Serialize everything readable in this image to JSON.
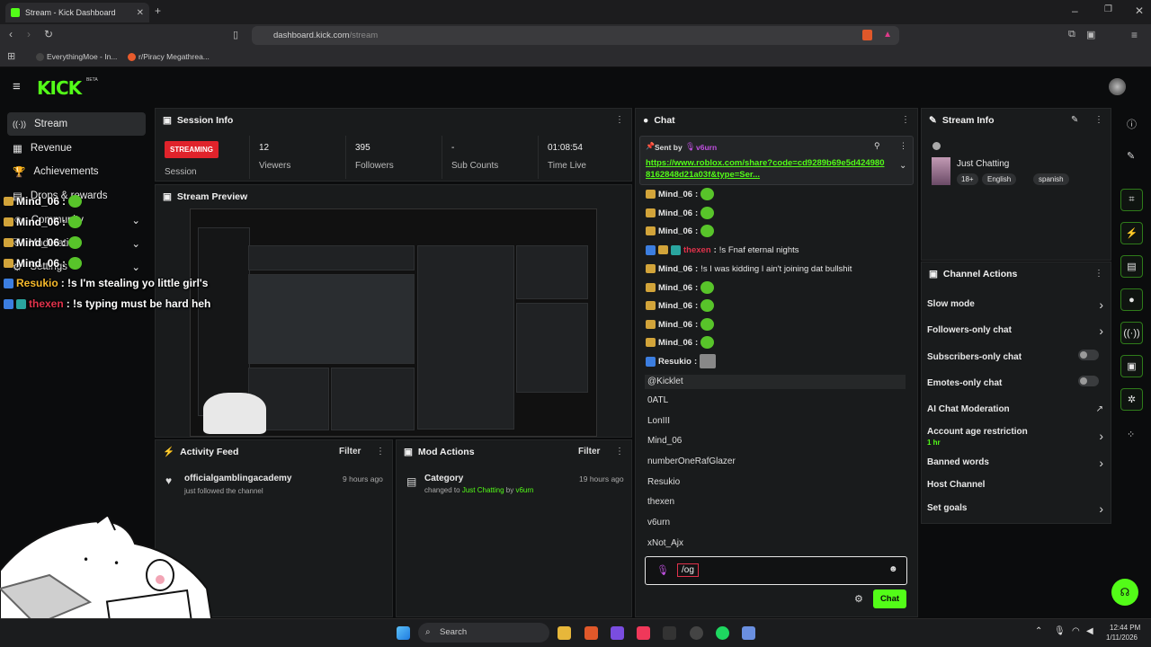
{
  "browser": {
    "tab_title": "Stream - Kick Dashboard",
    "url_host": "dashboard.kick.com",
    "url_path": "/stream",
    "bookmarks": [
      "EverythingMoe - In...",
      "r/Piracy Megathrea..."
    ]
  },
  "app": {
    "logo": "KICK",
    "logo_badge": "BETA",
    "accent": "#53fc18"
  },
  "sidebar": {
    "items": [
      {
        "label": "Stream",
        "icon": "stream-icon",
        "active": true
      },
      {
        "label": "Revenue",
        "icon": "revenue-icon"
      },
      {
        "label": "Achievements",
        "icon": "trophy-icon"
      },
      {
        "label": "Drops & rewards",
        "icon": "gift-icon"
      },
      {
        "label": "Community",
        "icon": "users-icon"
      },
      {
        "label": "Moderation",
        "icon": "shield-icon"
      },
      {
        "label": "Settings",
        "icon": "gear-icon"
      }
    ]
  },
  "session": {
    "title": "Session Info",
    "badge": "STREAMING",
    "session_label": "Session",
    "viewers_value": "12",
    "viewers_label": "Viewers",
    "followers_value": "395",
    "followers_label": "Followers",
    "subs_value": "-",
    "subs_label": "Sub Counts",
    "time_value": "01:08:54",
    "time_label": "Time Live"
  },
  "preview": {
    "title": "Stream Preview"
  },
  "activity": {
    "title": "Activity Feed",
    "filter": "Filter",
    "items": [
      {
        "user": "officialgamblingacademy",
        "detail": "just followed the channel",
        "time": "9 hours ago"
      }
    ]
  },
  "mod_actions": {
    "title": "Mod Actions",
    "filter": "Filter",
    "items": [
      {
        "title": "Category",
        "prefix": "changed to",
        "category": "Just Chatting",
        "by": "by",
        "user": "v6urn",
        "time": "19 hours ago"
      }
    ]
  },
  "chat": {
    "title": "Chat",
    "pinned": {
      "sent_by_label": "Sent by",
      "sender": "v6urn",
      "link": "https://www.roblox.com/share?code=cd9289b69e5d4249808162848d21a03f&type=Ser..."
    },
    "messages": [
      {
        "user": "Mind_06",
        "text": ""
      },
      {
        "user": "Mind_06",
        "text": ""
      },
      {
        "user": "Mind_06",
        "text": ""
      },
      {
        "user": "thexen",
        "text": "!s Fnaf eternal nights",
        "color": "#e0324b"
      },
      {
        "user": "Mind_06",
        "text": "!s I was kidding I ain't joining dat bullshit"
      },
      {
        "user": "Mind_06",
        "text": ""
      },
      {
        "user": "Mind_06",
        "text": ""
      },
      {
        "user": "Mind_06",
        "text": ""
      },
      {
        "user": "Mind_06",
        "text": ""
      },
      {
        "user": "Resukio",
        "text": ""
      }
    ],
    "suggestions": [
      "@Kicklet",
      "0ATL",
      "LonIII",
      "Mind_06",
      "numberOneRafGlazer",
      "Resukio",
      "thexen",
      "v6urn",
      "xNot_Ajx"
    ],
    "input_value": "/og",
    "send_label": "Chat"
  },
  "stream_info": {
    "title": "Stream Info",
    "category": "Just Chatting",
    "tags": [
      "18+",
      "English",
      "spanish"
    ]
  },
  "channel_actions": {
    "title": "Channel Actions",
    "rows": [
      {
        "label": "Slow mode",
        "kind": "chevron"
      },
      {
        "label": "Followers-only chat",
        "kind": "chevron"
      },
      {
        "label": "Subscribers-only chat",
        "kind": "toggle"
      },
      {
        "label": "Emotes-only chat",
        "kind": "toggle"
      },
      {
        "label": "AI Chat Moderation",
        "kind": "external"
      },
      {
        "label": "Account age restriction",
        "sub": "1 hr",
        "kind": "chevron"
      },
      {
        "label": "Banned words",
        "kind": "chevron"
      },
      {
        "label": "Host Channel",
        "kind": "none"
      },
      {
        "label": "Set goals",
        "kind": "chevron"
      }
    ]
  },
  "overlay_chat": [
    {
      "user": "Mind_06",
      "text": ":"
    },
    {
      "user": "Mind_06",
      "text": ":"
    },
    {
      "user": "Mind_06",
      "text": ":"
    },
    {
      "user": "Mind_06",
      "text": ":"
    },
    {
      "user": "Resukio",
      "text": ": !s I'm stealing yo little girl's",
      "color": "#f6b92b"
    },
    {
      "user": "thexen",
      "text": ": !s typing must be hard heh",
      "color": "#e0324b"
    }
  ],
  "taskbar": {
    "search_placeholder": "Search",
    "time": "12:44 PM",
    "date": "1/11/2026"
  }
}
